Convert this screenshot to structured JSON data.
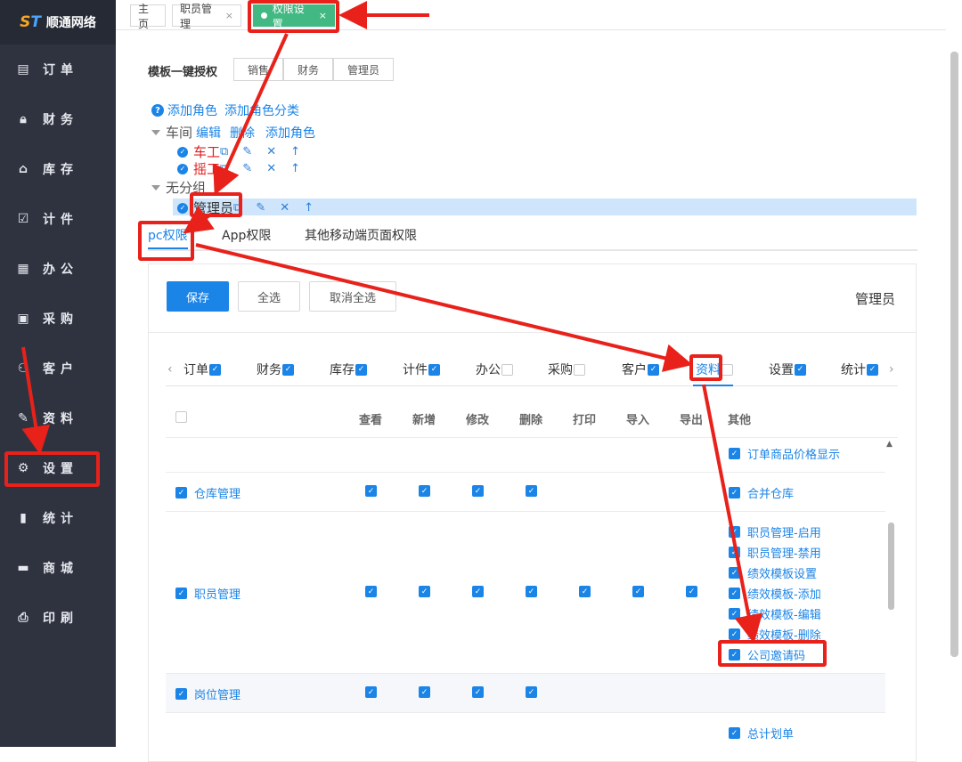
{
  "brand": {
    "logo_mark_a": "S",
    "logo_mark_b": "T",
    "name": "顺通网络"
  },
  "sidebar": {
    "items": [
      {
        "label": "订单",
        "icon": "order-icon"
      },
      {
        "label": "财务",
        "icon": "lock-icon"
      },
      {
        "label": "库存",
        "icon": "home-icon"
      },
      {
        "label": "计件",
        "icon": "clipboard-icon"
      },
      {
        "label": "办公",
        "icon": "calendar-icon"
      },
      {
        "label": "采购",
        "icon": "box-icon"
      },
      {
        "label": "客户",
        "icon": "user-icon"
      },
      {
        "label": "资料",
        "icon": "pen-icon"
      },
      {
        "label": "设置",
        "icon": "gear-icon"
      },
      {
        "label": "统计",
        "icon": "bar-chart-icon"
      },
      {
        "label": "商城",
        "icon": "store-icon"
      },
      {
        "label": "印刷",
        "icon": "printer-icon"
      }
    ]
  },
  "tabs": [
    {
      "label": "主页"
    },
    {
      "label": "职员管理",
      "close": "×"
    },
    {
      "label": "权限设置",
      "close": "×"
    }
  ],
  "template": {
    "label": "模板一键授权",
    "buttons": [
      "销售",
      "财务",
      "管理员"
    ]
  },
  "role_tree": {
    "help": "?",
    "add_role": "添加角色",
    "add_category": "添加角色分类",
    "group1": {
      "name": "车间",
      "edit": "编辑",
      "delete": "删除",
      "add_role": "添加角色",
      "roles": [
        "车工",
        "摇工"
      ]
    },
    "group2": {
      "name": "无分组",
      "roles": [
        "管理员"
      ]
    }
  },
  "perm_tabs": [
    "pc权限",
    "App权限",
    "其他移动端页面权限"
  ],
  "actions": {
    "save": "保存",
    "select_all": "全选",
    "deselect_all": "取消全选"
  },
  "current_role": "管理员",
  "modules": [
    {
      "label": "订单",
      "checked": true
    },
    {
      "label": "财务",
      "checked": true
    },
    {
      "label": "库存",
      "checked": true
    },
    {
      "label": "计件",
      "checked": true
    },
    {
      "label": "办公",
      "checked": false
    },
    {
      "label": "采购",
      "checked": false
    },
    {
      "label": "客户",
      "checked": true
    },
    {
      "label": "资料",
      "checked": false
    },
    {
      "label": "设置",
      "checked": true
    },
    {
      "label": "统计",
      "checked": true
    }
  ],
  "table": {
    "columns": [
      "查看",
      "新增",
      "修改",
      "删除",
      "打印",
      "导入",
      "导出",
      "其他"
    ],
    "rows": [
      {
        "name": "",
        "others": [
          "订单商品价格显示"
        ]
      },
      {
        "name": "仓库管理",
        "others": [
          "合并仓库"
        ]
      },
      {
        "name": "职员管理",
        "others": [
          "职员管理-启用",
          "职员管理-禁用",
          "绩效模板设置",
          "绩效模板-添加",
          "绩效模板-编辑",
          "绩效模板-删除",
          "公司邀请码"
        ]
      },
      {
        "name": "岗位管理",
        "others": []
      },
      {
        "name": "",
        "others": [
          "总计划单"
        ]
      }
    ]
  },
  "glyphs": {
    "check": "✓",
    "copy": "⧉",
    "edit": "✎",
    "close": "✕",
    "up": "↑",
    "left": "‹",
    "right": "›",
    "scroll_up": "▲"
  },
  "colors": {
    "accent": "#1b84e7",
    "active_tab": "#42b983",
    "sidebar": "#2f3340",
    "annotation": "#e8211b"
  }
}
